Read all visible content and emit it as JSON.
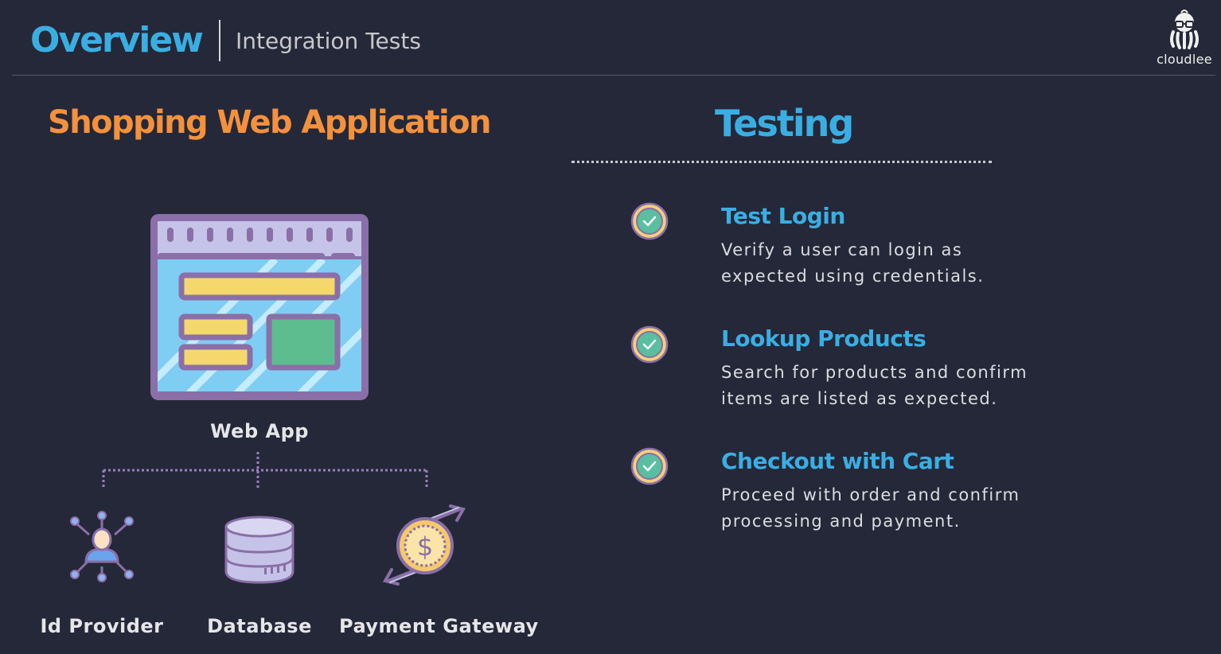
{
  "header": {
    "title": "Overview",
    "subtitle": "Integration Tests"
  },
  "brand": {
    "name": "cloudlee"
  },
  "left": {
    "heading": "Shopping Web Application",
    "main_node": {
      "label": "Web App",
      "icon": "web-app-window-icon"
    },
    "dependencies": [
      {
        "label": "Id Provider",
        "icon": "identity-network-icon"
      },
      {
        "label": "Database",
        "icon": "database-icon"
      },
      {
        "label": "Payment Gateway",
        "icon": "payment-exchange-icon"
      }
    ]
  },
  "right": {
    "heading": "Testing",
    "tests": [
      {
        "title": "Test Login",
        "description": "Verify a user can login as expected using credentials.",
        "icon": "check-circle-icon"
      },
      {
        "title": "Lookup Products",
        "description": "Search for products and confirm items are listed as expected.",
        "icon": "check-circle-icon"
      },
      {
        "title": "Checkout with Cart",
        "description": "Proceed with order and confirm processing and payment.",
        "icon": "check-circle-icon"
      }
    ]
  },
  "colors": {
    "background": "#252838",
    "accent_blue": "#3aaee3",
    "accent_orange": "#f4913d",
    "check_green": "#59bfa0",
    "icon_purple": "#8a6fa8"
  }
}
